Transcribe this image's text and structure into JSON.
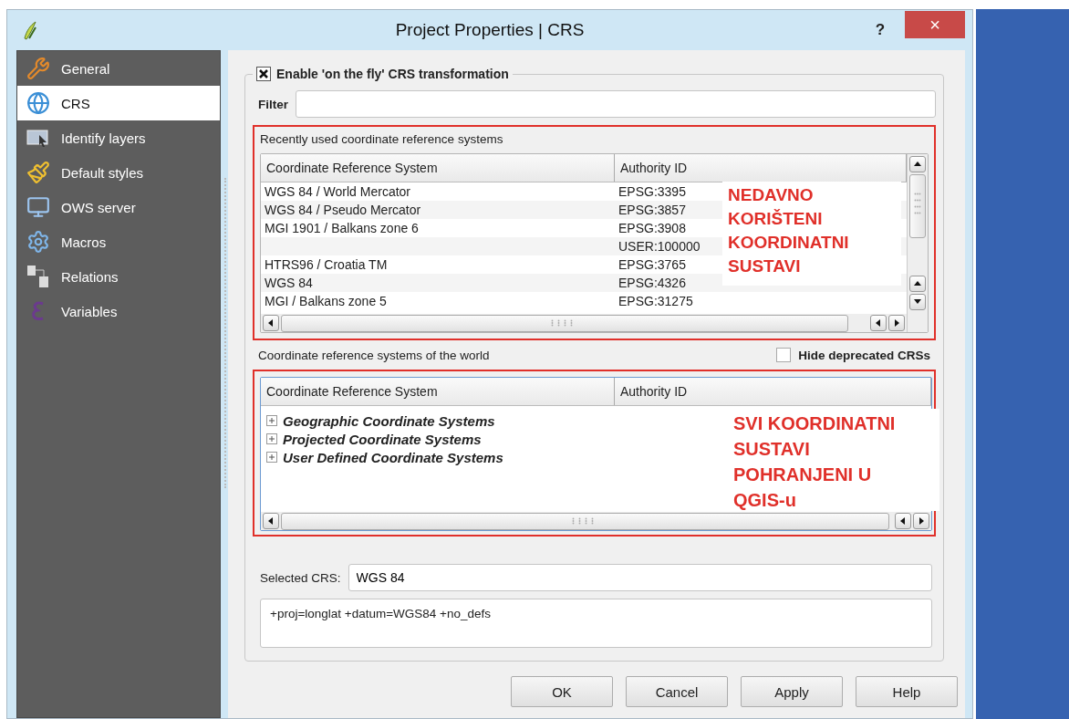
{
  "window": {
    "title": "Project Properties | CRS",
    "help": "?",
    "close": "×"
  },
  "sidebar": {
    "items": [
      {
        "label": "General",
        "selected": false
      },
      {
        "label": "CRS",
        "selected": true
      },
      {
        "label": "Identify layers",
        "selected": false
      },
      {
        "label": "Default styles",
        "selected": false
      },
      {
        "label": "OWS server",
        "selected": false
      },
      {
        "label": "Macros",
        "selected": false
      },
      {
        "label": "Relations",
        "selected": false
      },
      {
        "label": "Variables",
        "selected": false
      }
    ]
  },
  "on_the_fly": {
    "label": "Enable 'on the fly' CRS transformation",
    "checked": true
  },
  "filter": {
    "label": "Filter"
  },
  "recent": {
    "title": "Recently used coordinate reference systems",
    "columns": [
      "Coordinate Reference System",
      "Authority ID"
    ],
    "rows": [
      {
        "name": "WGS 84 / World Mercator",
        "authority": "EPSG:3395"
      },
      {
        "name": "WGS 84 / Pseudo Mercator",
        "authority": "EPSG:3857"
      },
      {
        "name": "MGI 1901 / Balkans zone 6",
        "authority": "EPSG:3908"
      },
      {
        "authority": "USER:100000"
      },
      {
        "name": "HTRS96 / Croatia TM",
        "authority": "EPSG:3765"
      },
      {
        "name": "WGS 84",
        "authority": "EPSG:4326"
      },
      {
        "name": "MGI / Balkans zone 5",
        "authority": "EPSG:31275"
      }
    ],
    "annotation": [
      "NEDAVNO",
      "KORIŠTENI",
      "KOORDINATNI",
      "SUSTAVI"
    ]
  },
  "world": {
    "title": "Coordinate reference systems of the world",
    "hide_deprecated": {
      "label": "Hide deprecated CRSs",
      "checked": false
    },
    "columns": [
      "Coordinate Reference System",
      "Authority ID"
    ],
    "tree": [
      {
        "label": "Geographic Coordinate Systems",
        "expanded": false
      },
      {
        "label": "Projected Coordinate Systems",
        "expanded": false
      },
      {
        "label": "User Defined Coordinate Systems",
        "expanded": false
      }
    ],
    "annotation": [
      "SVI KOORDINATNI",
      "SUSTAVI",
      "POHRANJENI U",
      "QGIS-u"
    ]
  },
  "selected_crs": {
    "label": "Selected CRS:",
    "value": "WGS 84"
  },
  "proj_string": "+proj=longlat +datum=WGS84 +no_defs",
  "buttons": [
    "OK",
    "Cancel",
    "Apply",
    "Help"
  ]
}
